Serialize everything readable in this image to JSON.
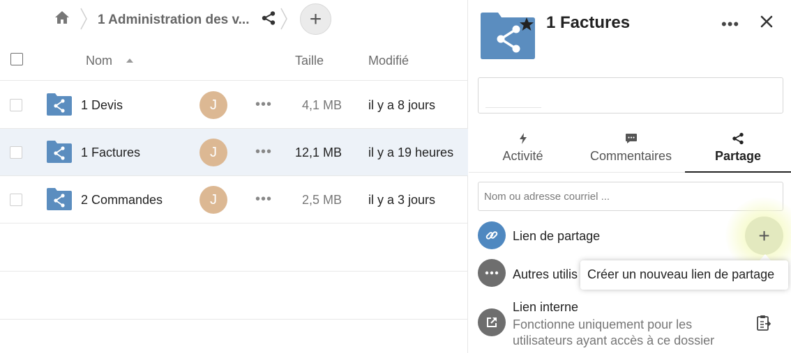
{
  "breadcrumb": {
    "current_folder": "1 Administration des v...",
    "add_label": "+"
  },
  "file_list": {
    "columns": {
      "name": "Nom",
      "size": "Taille",
      "modified": "Modifié"
    },
    "rows": [
      {
        "name": "1 Devis",
        "avatar_initial": "J",
        "size": "4,1 MB",
        "modified": "il y a 8 jours",
        "selected": false
      },
      {
        "name": "1 Factures",
        "avatar_initial": "J",
        "size": "12,1 MB",
        "modified": "il y a 19 heures",
        "selected": true
      },
      {
        "name": "2 Commandes",
        "avatar_initial": "J",
        "size": "2,5 MB",
        "modified": "il y a 3 jours",
        "selected": false
      }
    ],
    "actions_glyph": "•••"
  },
  "sidebar": {
    "title": "1 Factures",
    "more_glyph": "•••",
    "tabs": [
      {
        "label": "Activité",
        "icon": "lightning-icon"
      },
      {
        "label": "Commentaires",
        "icon": "comment-icon"
      },
      {
        "label": "Partage",
        "icon": "share-icon",
        "active": true
      }
    ],
    "share_input_placeholder": "Nom ou adresse courriel ...",
    "share_link_label": "Lien de partage",
    "add_link_glyph": "+",
    "tooltip": "Créer un nouveau lien de partage",
    "others_label": "Autres utilis",
    "internal_link_title": "Lien interne",
    "internal_link_desc": "Fonctionne uniquement pour les utilisateurs ayant accès à ce dossier"
  },
  "colors": {
    "folder_blue": "#5b8dbf",
    "avatar": "#dcb893",
    "selected_row": "#edf2f8",
    "link_icon_bg": "#4f88c0",
    "grey_icon_bg": "#6e6e6e",
    "add_link_bg": "#e3e9bf"
  }
}
